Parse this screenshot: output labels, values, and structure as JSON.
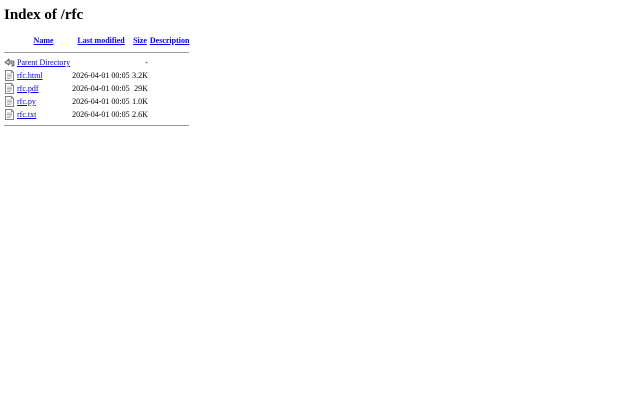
{
  "page": {
    "title": "Index of /rfc"
  },
  "table": {
    "headers": {
      "name": "Name",
      "last_modified": "Last modified",
      "size": "Size",
      "description": "Description"
    },
    "parent": {
      "icon": "back-icon",
      "name": "Parent Directory",
      "last_modified": "",
      "size": "-",
      "description": ""
    },
    "rows": [
      {
        "icon": "text-file-icon",
        "name": "rfc.html",
        "last_modified": "2026-04-01 00:05",
        "size": "3.2K",
        "description": ""
      },
      {
        "icon": "text-file-icon",
        "name": "rfc.pdf",
        "last_modified": "2026-04-01 00:05",
        "size": "29K",
        "description": ""
      },
      {
        "icon": "text-file-icon",
        "name": "rfc.py",
        "last_modified": "2026-04-01 00:05",
        "size": "1.0K",
        "description": ""
      },
      {
        "icon": "text-file-icon",
        "name": "rfc.txt",
        "last_modified": "2026-04-01 00:05",
        "size": "2.6K",
        "description": ""
      }
    ]
  },
  "colors": {
    "link": "#0000ee",
    "rule": "#9a9a9a"
  }
}
